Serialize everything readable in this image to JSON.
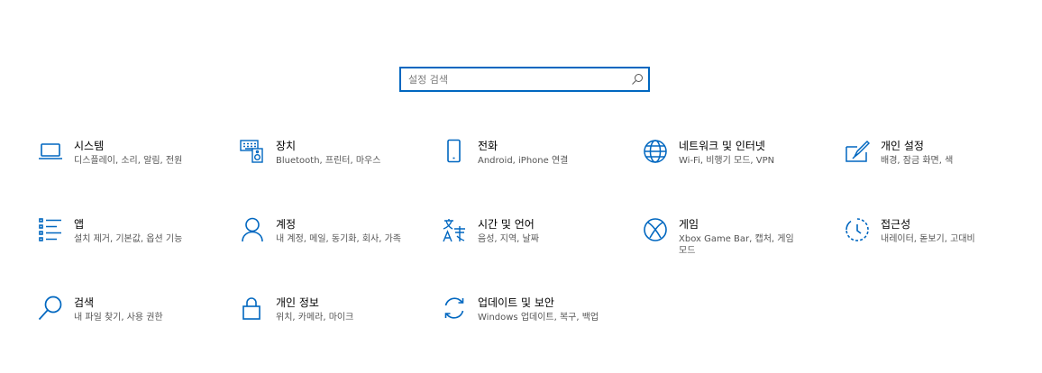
{
  "search": {
    "placeholder": "설정 검색"
  },
  "colors": {
    "accent": "#0067c0",
    "description": "#555555"
  },
  "tiles": [
    {
      "icon": "laptop-icon",
      "title": "시스템",
      "desc": "디스플레이, 소리, 알림, 전원"
    },
    {
      "icon": "keyboard-speaker-icon",
      "title": "장치",
      "desc": "Bluetooth, 프린터, 마우스"
    },
    {
      "icon": "phone-icon",
      "title": "전화",
      "desc": "Android, iPhone 연결"
    },
    {
      "icon": "globe-icon",
      "title": "네트워크 및 인터넷",
      "desc": "Wi-Fi, 비행기 모드, VPN"
    },
    {
      "icon": "paint-pen-icon",
      "title": "개인 설정",
      "desc": "배경, 잠금 화면, 색"
    },
    {
      "icon": "apps-list-icon",
      "title": "앱",
      "desc": "설치 제거, 기본값, 옵션 기능"
    },
    {
      "icon": "person-icon",
      "title": "계정",
      "desc": "내 계정, 메일, 동기화, 회사, 가족"
    },
    {
      "icon": "language-icon",
      "title": "시간 및 언어",
      "desc": "음성, 지역, 날짜"
    },
    {
      "icon": "xbox-icon",
      "title": "게임",
      "desc": "Xbox Game Bar, 캡처, 게임 모드"
    },
    {
      "icon": "ease-of-access-icon",
      "title": "접근성",
      "desc": "내레이터, 돋보기, 고대비"
    },
    {
      "icon": "search-icon",
      "title": "검색",
      "desc": "내 파일 찾기, 사용 권한"
    },
    {
      "icon": "lock-icon",
      "title": "개인 정보",
      "desc": "위치, 카메라, 마이크"
    },
    {
      "icon": "sync-icon",
      "title": "업데이트 및 보안",
      "desc": "Windows 업데이트, 복구, 백업"
    }
  ]
}
